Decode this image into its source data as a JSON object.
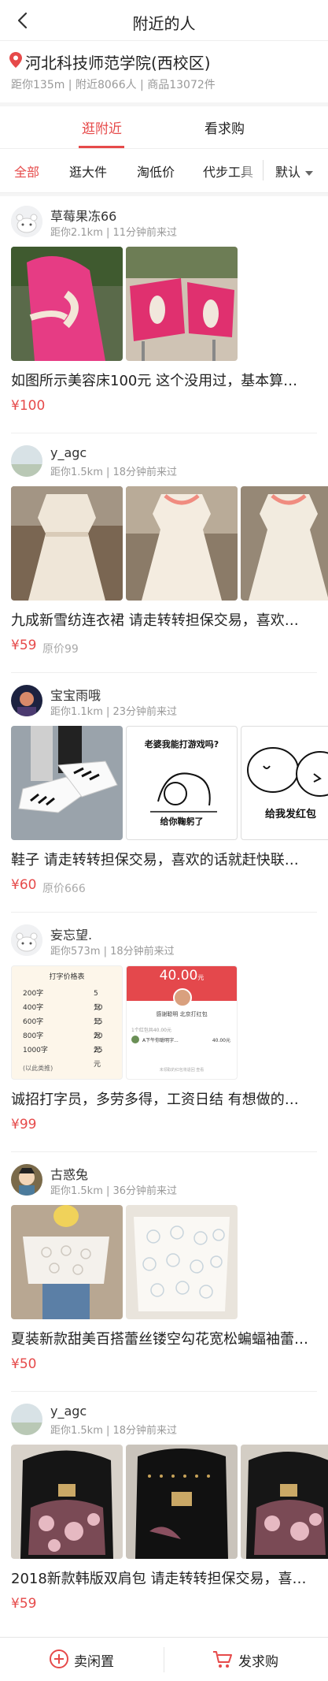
{
  "header": {
    "title": "附近的人"
  },
  "location": {
    "name": "河北科技师范学院(西校区)",
    "meta": "距你135m | 附近8066人 | 商品13072件"
  },
  "tabs": [
    {
      "label": "逛附近",
      "active": true
    },
    {
      "label": "看求购",
      "active": false
    }
  ],
  "filters": [
    {
      "label": "全部",
      "active": true
    },
    {
      "label": "逛大件",
      "active": false
    },
    {
      "label": "淘低价",
      "active": false
    },
    {
      "label": "代步工具",
      "active": false
    }
  ],
  "sort_label": "默认",
  "items": [
    {
      "user": "草莓果冻66",
      "meta": "距你2.1km | 11分钟前来过",
      "desc": "如图所示美容床100元 这个没用过，基本算…",
      "price": "¥100",
      "orig": ""
    },
    {
      "user": "y_agc",
      "meta": "距你1.5km | 18分钟前来过",
      "desc": "九成新雪纺连衣裙  请走转转担保交易，喜欢…",
      "price": "¥59",
      "orig": "原价99"
    },
    {
      "user": "宝宝雨哦",
      "meta": "距你1.1km | 23分钟前来过",
      "desc": "鞋子  请走转转担保交易，喜欢的话就赶快联…",
      "price": "¥60",
      "orig": "原价666"
    },
    {
      "user": "妄忘望.",
      "meta": "距你573m | 18分钟前来过",
      "desc": "诚招打字员，多劳多得，工资日结 有想做的…",
      "price": "¥99",
      "orig": ""
    },
    {
      "user": "古惑兔",
      "meta": "距你1.5km | 36分钟前来过",
      "desc": "夏装新款甜美百搭蕾丝镂空勾花宽松蝙蝠袖蕾…",
      "price": "¥50",
      "orig": ""
    },
    {
      "user": "y_agc",
      "meta": "距你1.5km | 18分钟前来过",
      "desc": "2018新款韩版双肩包 请走转转担保交易，喜…",
      "price": "¥59",
      "orig": ""
    }
  ],
  "photo_text": {
    "meme_top": "老婆我能打游戏吗?",
    "meme_bottom": "给你鞠躬了",
    "meme_right": "给我发红包",
    "price_table_title": "打字价格表",
    "price_rows": [
      [
        "200字",
        "5元"
      ],
      [
        "400字",
        "10元"
      ],
      [
        "600字",
        "15元"
      ],
      [
        "800字",
        "20元"
      ],
      [
        "1000字",
        "25元"
      ]
    ],
    "price_note": "(以此类推)",
    "redpacket_amount": "40.00",
    "redpacket_amount_unit": "元",
    "redpacket_from": "感谢聪明 北京打红包",
    "redpacket_record_head": "1个红包共40.00元",
    "redpacket_row_left": "A下午你聪明字...",
    "redpacket_row_right": "40.00元",
    "redpacket_footer": "未领取的红包将退回 查看"
  },
  "bottom": {
    "sell": "卖闲置",
    "want": "发求购"
  },
  "colors": {
    "accent": "#e64a4a",
    "muted": "#999999",
    "divider": "#eeeeee"
  }
}
